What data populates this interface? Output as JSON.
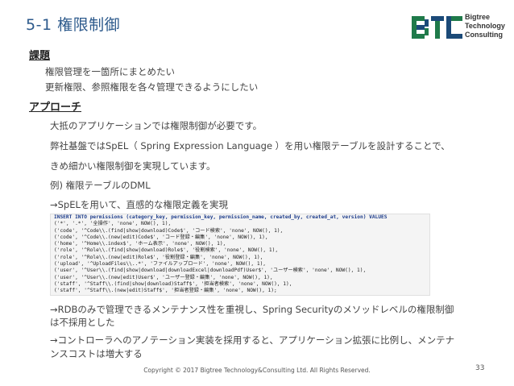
{
  "slide": {
    "title": "5-1 権限制御",
    "page_number": "33",
    "copyright": "Copyright © 2017 Bigtree Technology&Consulting Ltd. All Rights Reserved."
  },
  "logo": {
    "lines": [
      "Bigtree",
      "Technology",
      "Consulting"
    ]
  },
  "sections": {
    "issue_heading": "課題",
    "issue_lines": [
      "権限管理を一箇所にまとめたい",
      "更新権限、参照権限を各々管理できるようにしたい"
    ],
    "approach_heading": "アプローチ",
    "approach_lines": [
      "大抵のアプリケーションでは権限制御が必要です。",
      "弊社基盤ではSpEL（ Spring Expression Language ）を用い権限テーブルを設計することで、",
      "きめ細かい権限制御を実現しています。",
      "例) 権限テーブルのDML",
      "→SpELを用いて、直感的な権限定義を実現"
    ],
    "notes": [
      "→RDBのみで管理できるメンテナンス性を重視し、Spring Securityのメソッドレベルの権限制御",
      "は不採用とした",
      "→コントローラへのアノテーション実装を採用すると、アプリケーション拡張に比例し、メンテナ",
      "ンスコストは増大する"
    ]
  },
  "code": [
    "INSERT INTO permissions (category_key, permission_key, permission_name, created_by, created_at, version) VALUES",
    "('*', '.*', '全操作', 'none', NOW(), 1),",
    "('code', '^Code\\\\.(find|show|download)Code$', 'コード検索', 'none', NOW(), 1),",
    "('code', '^Code\\\\.(new|edit)Code$', 'コード登録・編集', 'none', NOW(), 1),",
    "('home', '^Home\\\\.index$', 'ホーム表示', 'none', NOW(), 1),",
    "('role', '^Role\\\\.(find|show|download)Role$', '役割検索', 'none', NOW(), 1),",
    "('role', '^Role\\\\.(new|edit)Role$', '役割登録・編集', 'none', NOW(), 1),",
    "('upload', '^UploadFiles\\\\..*', 'ファイルアップロード', 'none', NOW(), 1),",
    "('user', '^User\\\\.(find|show|download|downloadExcel|downloadPdf)User$', 'ユーザー検索', 'none', NOW(), 1),",
    "('user', '^User\\\\.(new|edit)User$', 'ユーザー登録・編集', 'none', NOW(), 1),",
    "('staff', '^Staff\\\\.(find|show|download)Staff$', '担当者検索', 'none', NOW(), 1),",
    "('staff', '^Staff\\\\.(new|edit)Staff$', '担当者登録・編集', 'none', NOW(), 1);"
  ],
  "colors": {
    "title": "#2d5a8c",
    "logo_green": "#1f7a4a",
    "logo_dark": "#1b4a78"
  }
}
